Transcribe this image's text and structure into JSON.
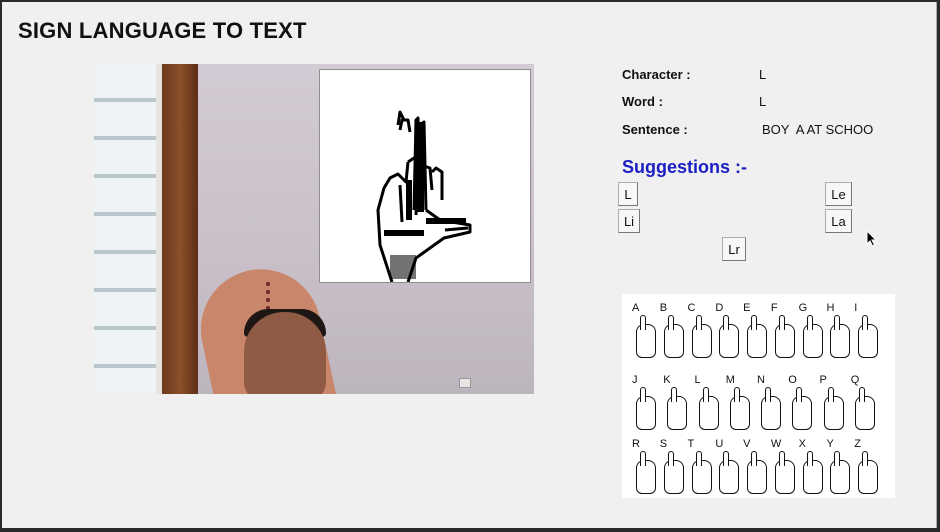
{
  "app": {
    "title": "SIGN LANGUAGE TO TEXT"
  },
  "info": {
    "character_label": "Character :",
    "character_value": "L",
    "word_label": "Word :",
    "word_value": "L",
    "sentence_label": "Sentence :",
    "sentence_value": "BOY  A AT SCHOO"
  },
  "suggestions": {
    "title": "Suggestions :-",
    "items": [
      "L",
      "Le",
      "Li",
      "La",
      "Lr"
    ]
  },
  "asl_chart": {
    "letters": [
      "A",
      "B",
      "C",
      "D",
      "E",
      "F",
      "G",
      "H",
      "I",
      "J",
      "K",
      "L",
      "M",
      "N",
      "O",
      "P",
      "Q",
      "R",
      "S",
      "T",
      "U",
      "V",
      "W",
      "X",
      "Y",
      "Z"
    ]
  },
  "colors": {
    "accent": "#1c20c4",
    "background": "#f0f0f0"
  }
}
